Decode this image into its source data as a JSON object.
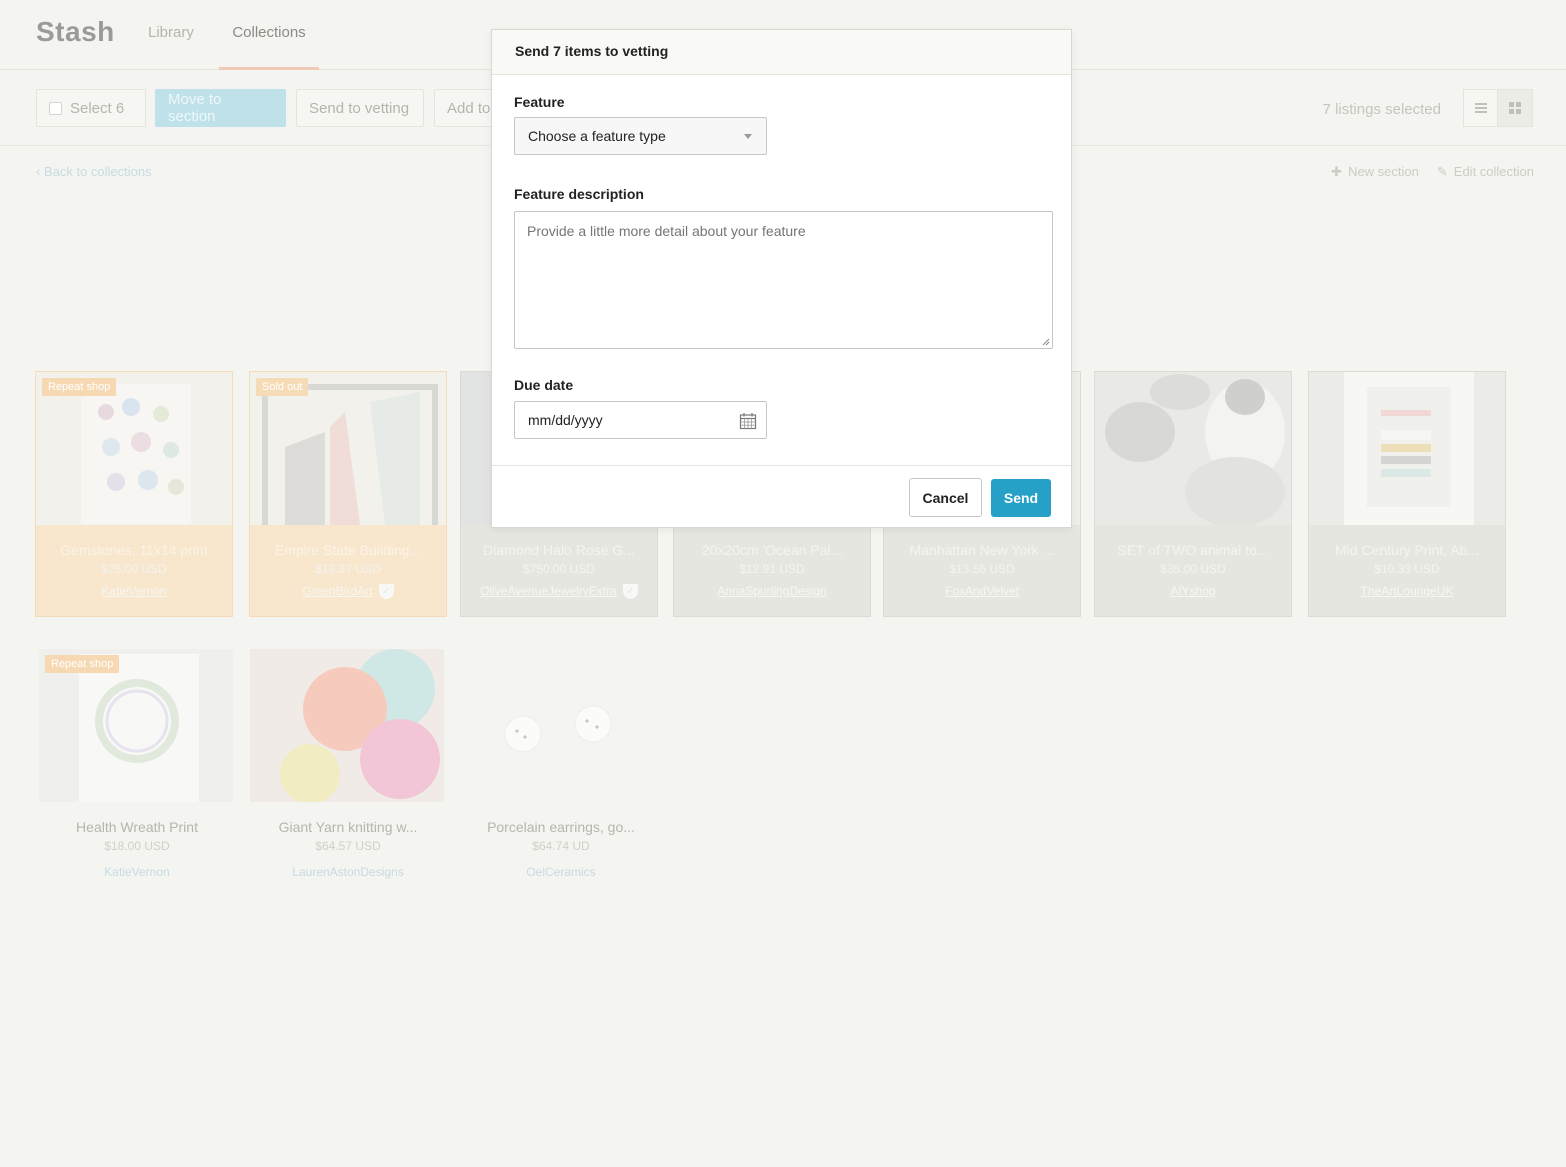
{
  "app": {
    "logo": "Stash"
  },
  "nav": {
    "tabs": [
      {
        "label": "Library"
      },
      {
        "label": "Collections"
      }
    ]
  },
  "toolbar": {
    "select_label": "Select 6",
    "move_label": "Move to section",
    "vetting_label": "Send to vetting",
    "add_label": "Add to",
    "selected_count": "7 listings selected"
  },
  "subnav": {
    "back_label": "‹ Back to collections",
    "new_section_label": "New section",
    "edit_collection_label": "Edit collection"
  },
  "listings_row1": [
    {
      "title": "Gemstones, 11x14 print",
      "price": "$25.00 USD",
      "seller": "KatieVernon",
      "badge": "Repeat shop"
    },
    {
      "title": "Empire State Building...",
      "price": "$19.37 USD",
      "seller": "GreenBirdArt",
      "badge": "Sold out"
    },
    {
      "title": "Diamond Halo Rose G...",
      "price": "$750.00 USD",
      "seller": "OliveAvenueJewelryExtra",
      "badge": ""
    },
    {
      "title": "20x20cm 'Ocean Pal...",
      "price": "$12.91 USD",
      "seller": "AnnaSpurlingDesign",
      "badge": ""
    },
    {
      "title": "Manhattan New York ...",
      "price": "$13.56 USD",
      "seller": "FoxAndVelvet",
      "badge": ""
    },
    {
      "title": "SET of TWO animal to...",
      "price": "$35.00 USD",
      "seller": "AIYshop",
      "badge": ""
    },
    {
      "title": "Mid Century Print, Ab...",
      "price": "$10.33 USD",
      "seller": "TheArtLoungeUK",
      "badge": ""
    }
  ],
  "listings_row2": [
    {
      "title": "Health Wreath Print",
      "price": "$18.00 USD",
      "seller": "KatieVernon",
      "badge": "Repeat shop"
    },
    {
      "title": "Giant Yarn knitting w...",
      "price": "$64.57 USD",
      "seller": "LaurenAstonDesigns",
      "badge": ""
    },
    {
      "title": "Porcelain earrings, go...",
      "price": "$64.74 UD",
      "seller": "OelCeramics",
      "badge": ""
    }
  ],
  "modal": {
    "title": "Send 7 items to vetting",
    "feature_label": "Feature",
    "feature_value": "Choose a feature type",
    "description_label": "Feature description",
    "description_placeholder": "Provide a little more detail about your feature",
    "due_label": "Due date",
    "due_value": "mm/dd/yyyy",
    "cancel_label": "Cancel",
    "send_label": "Send"
  },
  "colors": {
    "accent": "#27a0c7",
    "warm_card": "#f8e7cd",
    "background": "#f4f4f0"
  },
  "icons": [
    "list-view-icon",
    "grid-view-icon",
    "plus-icon",
    "pencil-icon",
    "shield-icon",
    "calendar-icon",
    "chevron-down-icon"
  ]
}
